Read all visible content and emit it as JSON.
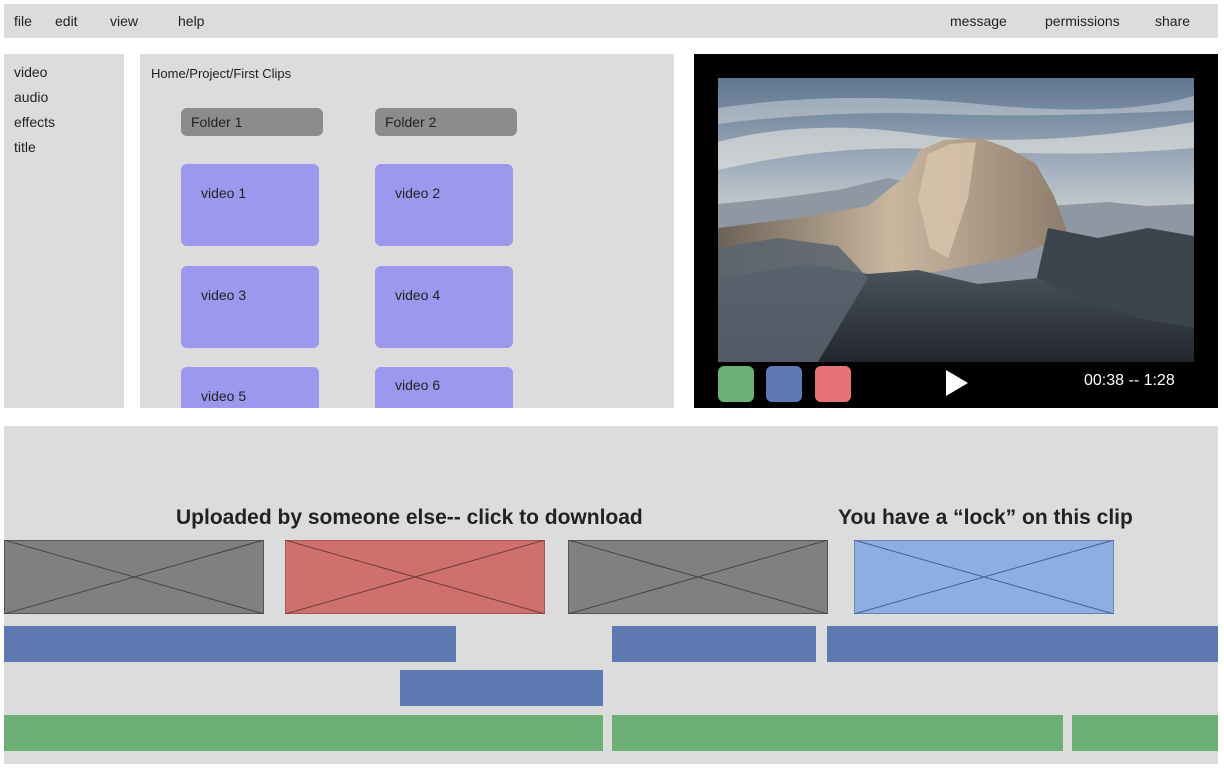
{
  "menu": {
    "left": [
      "file",
      "edit",
      "view",
      "help"
    ],
    "right": [
      "message",
      "permissions",
      "share"
    ]
  },
  "sidebar": {
    "items": [
      "video",
      "audio",
      "effects",
      "title"
    ]
  },
  "browser": {
    "breadcrumb": "Home/Project/First Clips",
    "folders": [
      "Folder 1",
      "Folder 2"
    ],
    "videos": [
      "video 1",
      "video 2",
      "video 3",
      "video 4",
      "video 5",
      "video 6"
    ]
  },
  "player": {
    "time": "00:38 -- 1:28",
    "controls": [
      {
        "name": "green",
        "color": "#6cb076"
      },
      {
        "name": "blue",
        "color": "#5c7ab1"
      },
      {
        "name": "red",
        "color": "#e57373"
      }
    ]
  },
  "timeline": {
    "notes": {
      "uploaded": "Uploaded by someone else-- click to download",
      "locked": "You have a “lock” on this clip"
    },
    "clip_colors": {
      "gray": "#808080",
      "red": "#d0706c",
      "blue": "#8eaee2"
    },
    "track_colors": {
      "video": "#5c7ab1",
      "audio": "#6cb076"
    }
  }
}
